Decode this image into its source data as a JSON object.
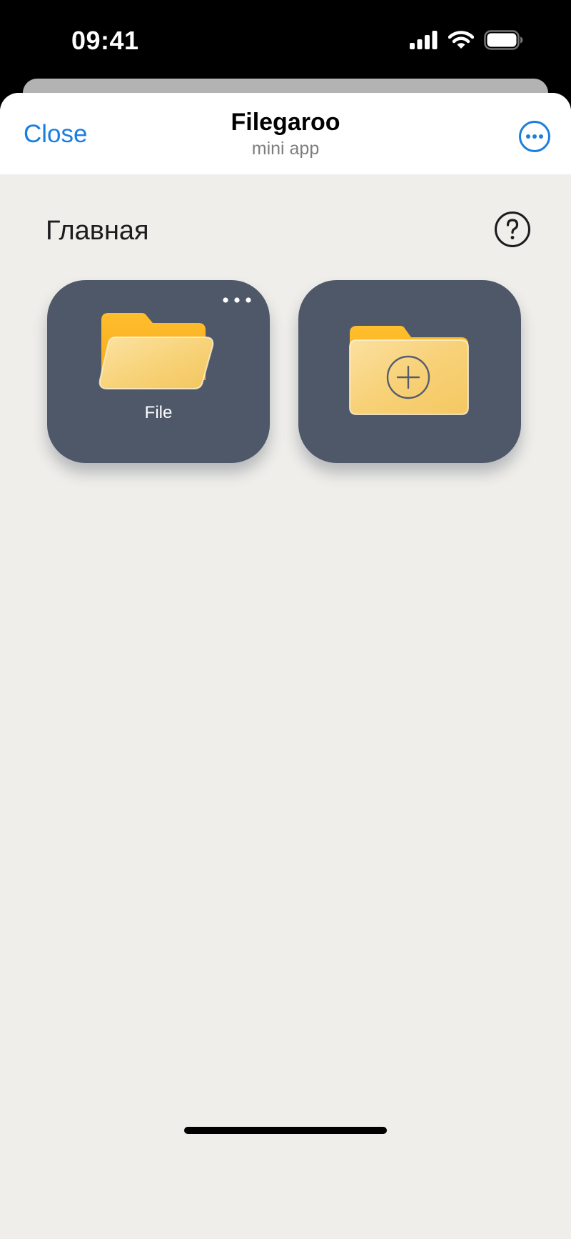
{
  "status_bar": {
    "time": "09:41",
    "icons": [
      "cellular-signal-icon",
      "wifi-icon",
      "battery-icon"
    ]
  },
  "nav": {
    "close_label": "Close",
    "title": "Filegaroo",
    "subtitle": "mini app",
    "more_icon": "ellipsis-circle-icon"
  },
  "main": {
    "section_title": "Главная",
    "help_icon": "question-circle-icon",
    "tiles": [
      {
        "label": "File",
        "icon": "folder-open-icon",
        "menu_icon": "ellipsis-icon"
      },
      {
        "label": "",
        "icon": "folder-add-icon"
      }
    ]
  },
  "colors": {
    "accent": "#1a7ee0",
    "sheet_background": "#efeeea",
    "tile_background": "#4e5869",
    "folder_yellow": "#ffc83d"
  }
}
